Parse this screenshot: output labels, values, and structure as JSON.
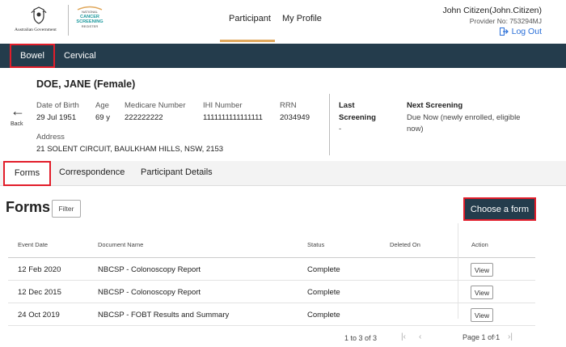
{
  "header": {
    "gov_logo_text": "Australian Government",
    "ncsr_logo": {
      "line1": "NATIONAL",
      "line2": "CANCER",
      "line3": "SCREENING",
      "line4": "REGISTER"
    },
    "nav": {
      "participant": "Participant",
      "my_profile": "My Profile"
    },
    "user_name": "John Citizen(John.Citizen)",
    "provider": "Provider No: 753294MJ",
    "logout": "Log Out",
    "accent_color": "#e0a85c",
    "link_color": "#2a6fd8"
  },
  "program_tabs": {
    "bowel": "Bowel",
    "cervical": "Cervical",
    "bar_color": "#243c4c",
    "highlight_color": "#e21d2a"
  },
  "participant": {
    "name": "DOE, JANE (Female)",
    "back_label": "Back",
    "dob_label": "Date of Birth",
    "dob": "29 Jul 1951",
    "age_label": "Age",
    "age": "69 y",
    "medicare_label": "Medicare Number",
    "medicare": "222222222",
    "ihi_label": "IHI Number",
    "ihi": "1111111111111111",
    "rrn_label": "RRN",
    "rrn": "2034949",
    "address_label": "Address",
    "address": "21 SOLENT CIRCUIT, BAULKHAM HILLS, NSW, 2153",
    "last_screening_label_1": "Last",
    "last_screening_label_2": "Screening",
    "last_screening": "-",
    "next_screening_label": "Next Screening",
    "next_screening_1": "Due Now (newly enrolled, eligible",
    "next_screening_2": "now)"
  },
  "section_tabs": {
    "forms": "Forms",
    "correspondence": "Correspondence",
    "details": "Participant Details"
  },
  "forms": {
    "title": "Forms",
    "filter": "Filter",
    "choose": "Choose a form",
    "columns": {
      "date": "Event Date",
      "doc": "Document Name",
      "status": "Status",
      "deleted": "Deleted On",
      "action": "Action"
    },
    "rows": [
      {
        "date": "12 Feb 2020",
        "doc": "NBCSP - Colonoscopy Report",
        "status": "Complete",
        "deleted": "",
        "action": "View"
      },
      {
        "date": "12 Dec 2015",
        "doc": "NBCSP - Colonoscopy Report",
        "status": "Complete",
        "deleted": "",
        "action": "View"
      },
      {
        "date": "24 Oct 2019",
        "doc": "NBCSP - FOBT Results and Summary",
        "status": "Complete",
        "deleted": "",
        "action": "View"
      }
    ],
    "pager": {
      "range": "1 to 3 of 3",
      "page_label": "Page",
      "page": "1",
      "of_label": "of",
      "total": "1"
    }
  }
}
